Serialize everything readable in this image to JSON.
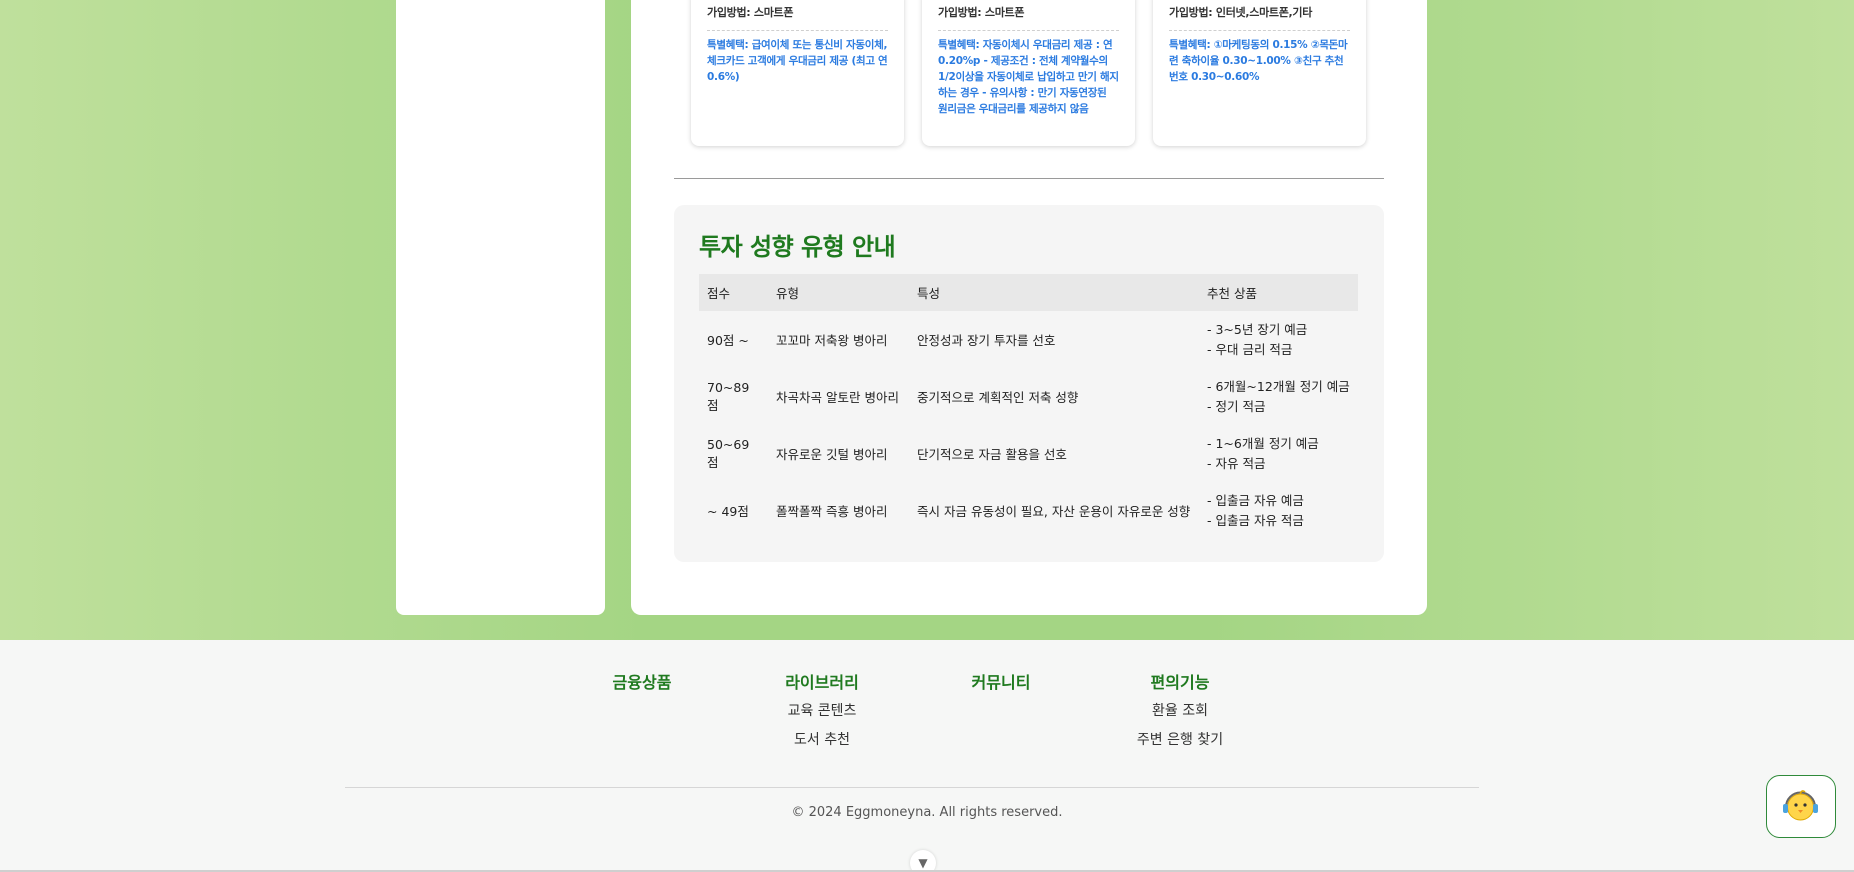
{
  "cards": [
    {
      "method": "가입방법: 스마트폰",
      "benefit": "특별혜택: 급여이체 또는 통신비 자동이체, 체크카드 고객에게 우대금리 제공 (최고 연 0.6%)"
    },
    {
      "method": "가입방법: 스마트폰",
      "benefit": "특별혜택: 자동이체시 우대금리 제공 : 연 0.20%p - 제공조건 : 전체 계약월수의 1/2이상을 자동이체로 납입하고 만기 해지하는 경우 - 유의사항 : 만기 자동연장된 원리금은 우대금리를 제공하지 않음"
    },
    {
      "method": "가입방법: 인터넷,스마트폰,기타",
      "benefit": "특별혜택: ①마케팅동의 0.15% ②목돈마련 축하이율 0.30~1.00% ③친구 추천번호 0.30~0.60%"
    }
  ],
  "guide": {
    "title": "투자 성향 유형 안내",
    "headers": [
      "점수",
      "유형",
      "특성",
      "추천 상품"
    ],
    "rows": [
      {
        "score": "90점 ~",
        "type": "꼬꼬마 저축왕 병아리",
        "trait": "안정성과 장기 투자를 선호",
        "rec1": "- 3~5년 장기 예금",
        "rec2": "- 우대 금리 적금"
      },
      {
        "score": "70~89점",
        "type": "차곡차곡 알토란 병아리",
        "trait": "중기적으로 계획적인 저축 성향",
        "rec1": "- 6개월~12개월 정기 예금",
        "rec2": "- 정기 적금"
      },
      {
        "score": "50~69점",
        "type": "자유로운 깃털 병아리",
        "trait": "단기적으로 자금 활용을 선호",
        "rec1": "- 1~6개월 정기 예금",
        "rec2": "- 자유 적금"
      },
      {
        "score": "~ 49점",
        "type": "폴짝폴짝 즉흥 병아리",
        "trait": "즉시 자금 유동성이 필요, 자산 운용이 자유로운 성향",
        "rec1": "- 입출금 자유 예금",
        "rec2": "- 입출금 자유 적금"
      }
    ]
  },
  "footer": {
    "columns": [
      {
        "title": "금융상품",
        "links": []
      },
      {
        "title": "라이브러리",
        "links": [
          "교육 콘텐츠",
          "도서 추천"
        ]
      },
      {
        "title": "커뮤니티",
        "links": []
      },
      {
        "title": "편의기능",
        "links": [
          "환율 조회",
          "주변 은행 찾기"
        ]
      }
    ],
    "copyright": "© 2024 Eggmoneyna. All rights reserved."
  },
  "icons": {
    "scroll": "chevron-down-icon",
    "chat": "chick-headset-icon"
  },
  "colors": {
    "accent_green": "#1f7a1f",
    "benefit_blue": "#2b7be0",
    "bg_green": "#a4d584"
  }
}
